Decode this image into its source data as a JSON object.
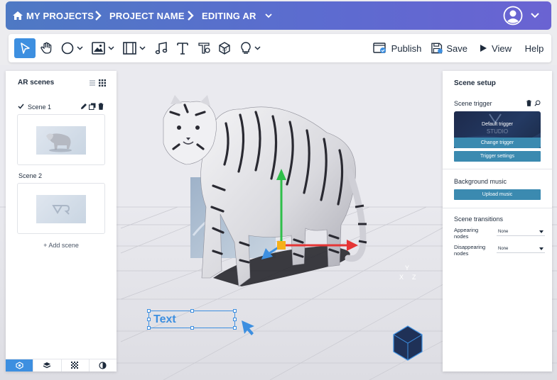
{
  "header": {
    "breadcrumbs": [
      "MY PROJECTS",
      "PROJECT NAME",
      "EDITING AR"
    ],
    "icons": {
      "home": "home-icon",
      "chevron": "chevron-right-icon",
      "dropdown": "chevron-down-icon",
      "avatar": "user-avatar-icon"
    }
  },
  "toolbar": {
    "publish_label": "Publish",
    "save_label": "Save",
    "view_label": "View",
    "help_label": "Help",
    "tools": [
      "pointer",
      "hand",
      "shape",
      "image",
      "video",
      "music",
      "text",
      "sticker",
      "3d-object",
      "light"
    ]
  },
  "left_panel": {
    "title": "AR scenes",
    "scenes": [
      {
        "label": "Scene 1",
        "selected": true
      },
      {
        "label": "Scene 2",
        "selected": false
      }
    ],
    "add_scene_label": "+ Add scene"
  },
  "right_panel": {
    "title": "Scene setup",
    "scene_trigger_label": "Scene trigger",
    "trigger_card": {
      "line1": "Default trigger",
      "line2": "STUDIO"
    },
    "change_trigger_label": "Change trigger",
    "trigger_settings_label": "Trigger settings",
    "background_music_label": "Background music",
    "upload_music_label": "Upload music",
    "scene_transitions_label": "Scene transitions",
    "appearing_label": "Appearing nodes",
    "appearing_value": "None",
    "disappearing_label": "Disappearing nodes",
    "disappearing_value": "None"
  },
  "viewport": {
    "text_node_label": "Text",
    "gizmo": {
      "top": "Y",
      "left": "X",
      "right": "Z"
    }
  },
  "colors": {
    "accent": "#3d8fe0",
    "header_start": "#4e79c4",
    "header_end": "#6a63d2",
    "button": "#3b8ab0",
    "axis_x": "#e53535",
    "axis_y": "#2fbf4a",
    "axis_z": "#3d8fe0",
    "gizmo_bg": "#1f3157"
  }
}
